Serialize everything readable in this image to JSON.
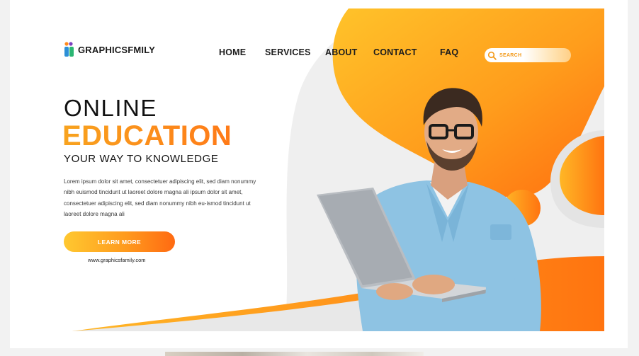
{
  "brand": {
    "name": "GRAPHICSFMILY"
  },
  "nav": {
    "items": [
      {
        "label": "HOME"
      },
      {
        "label": "SERVICES"
      },
      {
        "label": "ABOUT"
      },
      {
        "label": "CONTACT"
      },
      {
        "label": "FAQ"
      }
    ]
  },
  "search": {
    "placeholder": "SEARCH"
  },
  "hero": {
    "line1": "ONLINE",
    "line2": "EDUCATION",
    "tagline": "YOUR WAY TO KNOWLEDGE",
    "body": "Lorem ipsum dolor sit amet, consectetuer adipiscing elit, sed diam nonummy nibh euismod tincidunt ut laoreet dolore magna ali ipsum dolor sit amet, consectetuer adipiscing elit, sed diam nonummy nibh eu-ismod tincidunt ut laoreet dolore magna ali",
    "cta_label": "LEARN MORE",
    "url": "www.graphicsfamily.com"
  },
  "colors": {
    "accent_orange": "#ff7a18",
    "accent_yellow": "#ffc830",
    "text_dark": "#111111",
    "shirt_blue": "#8ec3e3"
  },
  "icons": [
    "logo-mark-icon",
    "search-icon"
  ]
}
